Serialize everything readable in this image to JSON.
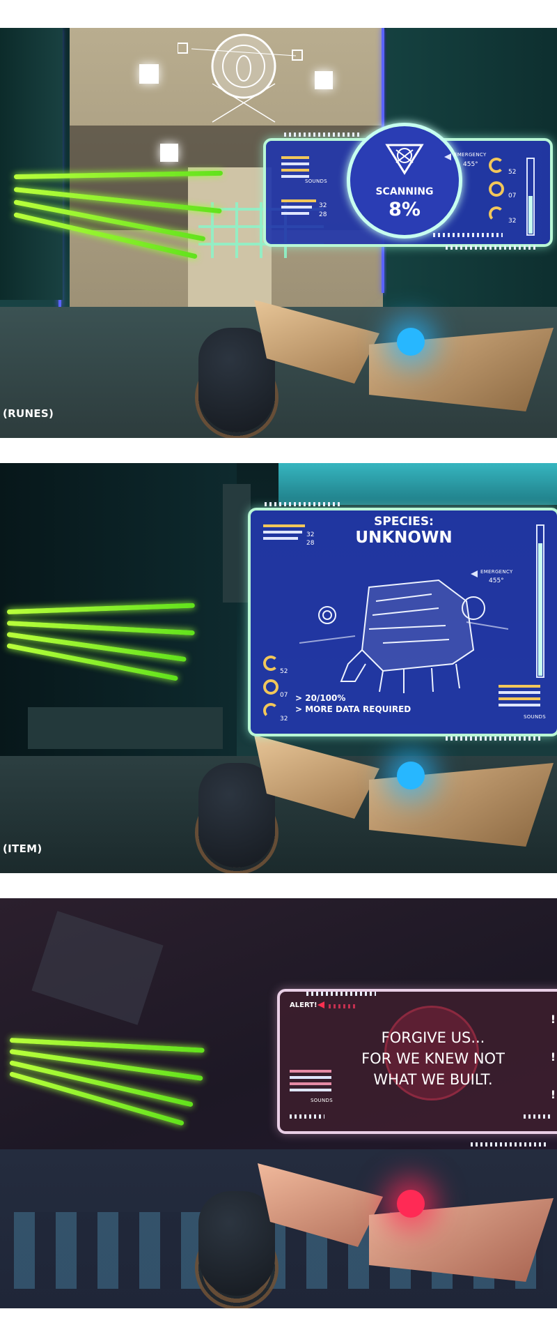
{
  "panels": [
    {
      "caption": "(RUNES)",
      "hud": {
        "status": "SCANNING",
        "progress": "8%",
        "progress_value": 8,
        "emergency_label": "EMERGENCY",
        "heading": "455°",
        "readings": [
          "52",
          "07",
          "32"
        ],
        "left_values": [
          "32",
          "28"
        ],
        "sounds_label": "SOUNDS"
      }
    },
    {
      "caption": "(ITEM)",
      "hud": {
        "species_label": "SPECIES:",
        "species_value": "UNKNOWN",
        "emergency_label": "EMERGENCY",
        "heading": "455°",
        "readings": [
          "52",
          "07",
          "32"
        ],
        "top_values": [
          "32",
          "28"
        ],
        "data_progress": "> 20/100%",
        "data_note": "> MORE DATA REQUIRED",
        "sounds_label": "SOUNDS"
      }
    },
    {
      "caption": "",
      "hud": {
        "alert_label": "ALERT!",
        "message_lines": [
          "FORGIVE US...",
          "FOR WE KNEW NOT",
          "WHAT WE BUILT."
        ],
        "sounds_label": "SOUNDS",
        "markers": [
          "!",
          "!",
          "!"
        ]
      }
    }
  ],
  "colors": {
    "hud_blue": "#2337aa",
    "hud_border": "#b9f7d5",
    "accent_yellow": "#f2c75a",
    "beam_green": "#9bff3a",
    "gem_blue": "#27b7ff",
    "gem_red": "#ff2a55"
  },
  "icons": [
    "rune-sigil-icon",
    "creature-hologram-icon",
    "emergency-arrow-icon",
    "alert-arrow-icon"
  ]
}
